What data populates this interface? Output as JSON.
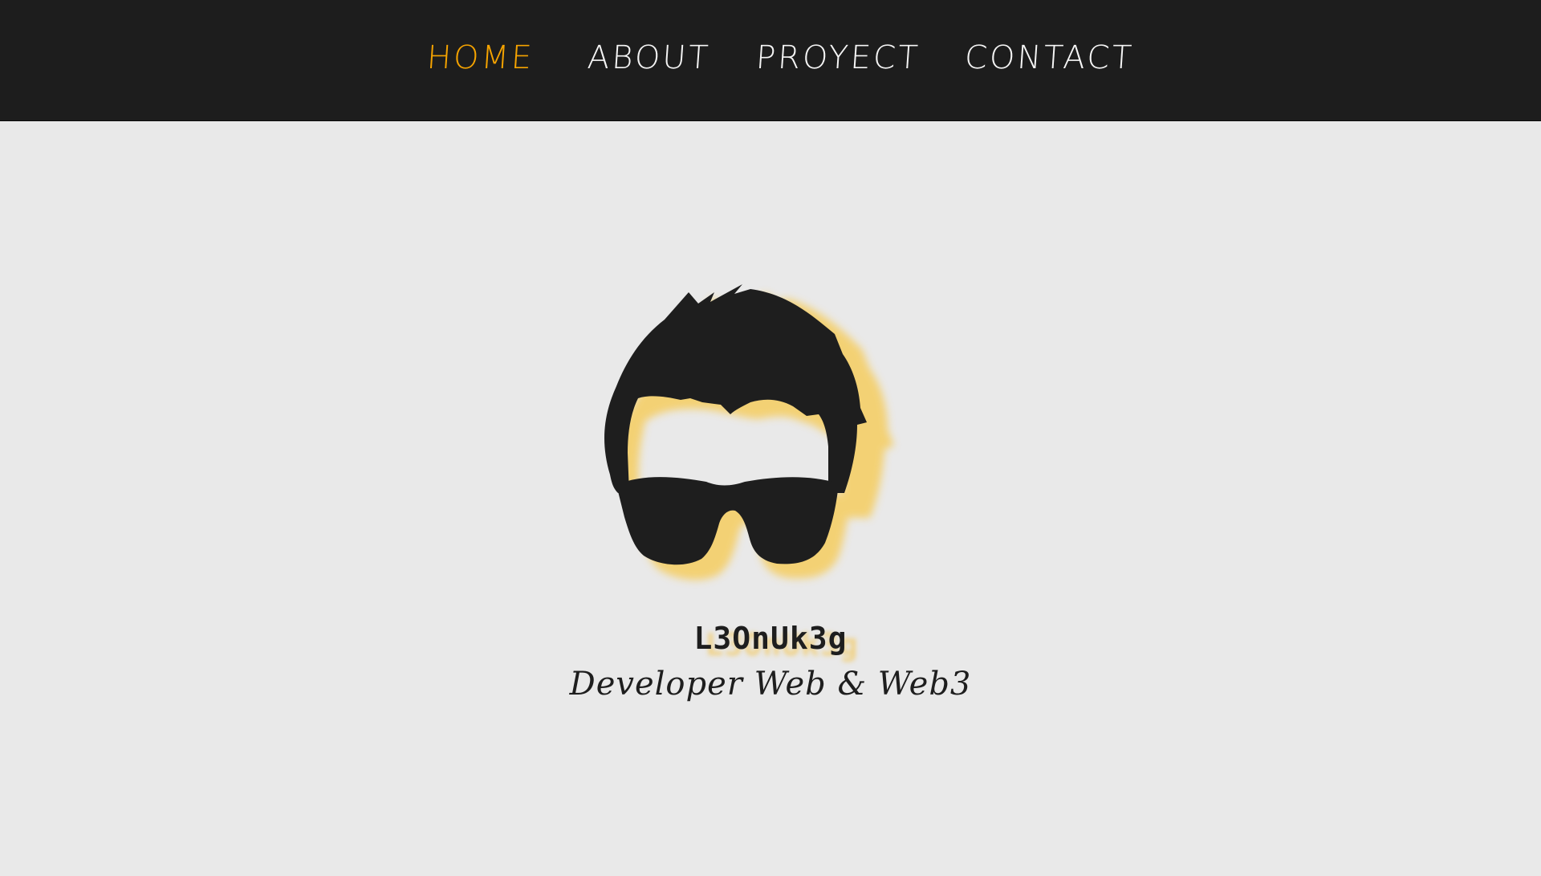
{
  "nav": {
    "items": [
      {
        "label": "HOME",
        "active": true
      },
      {
        "label": "ABOUT",
        "active": false
      },
      {
        "label": "PROYECT",
        "active": false
      },
      {
        "label": "CONTACT",
        "active": false
      }
    ]
  },
  "hero": {
    "logo_icon": "avatar-sunglasses-icon",
    "brand": "L3OnUk3g",
    "tagline": "Developer Web & Web3"
  },
  "colors": {
    "navbar_bg": "#1d1d1d",
    "page_bg": "#e9e9e9",
    "accent": "#f5a300",
    "nav_text": "#f5f5f5",
    "logo_dark": "#1e1e1e",
    "logo_glow": "#f7c94e"
  }
}
